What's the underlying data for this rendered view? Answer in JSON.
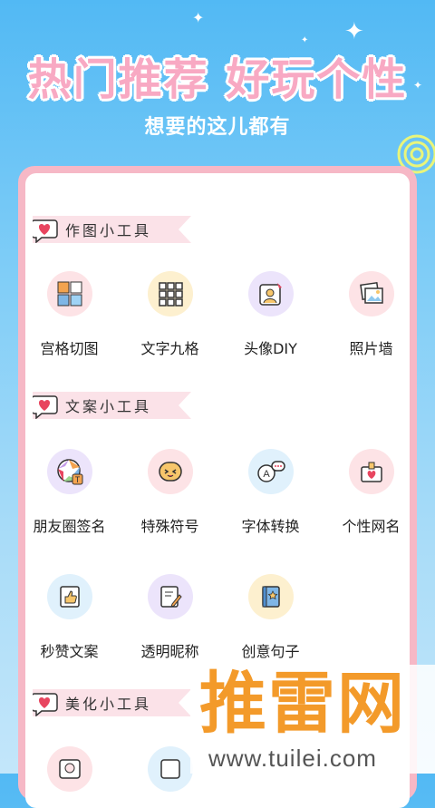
{
  "hero": {
    "title": "热门推荐  好玩个性",
    "subtitle": "想要的这儿都有"
  },
  "sections": [
    {
      "title": "作图小工具",
      "icon": "heart-chat-icon"
    },
    {
      "title": "文案小工具",
      "icon": "heart-chat-icon"
    },
    {
      "title": "美化小工具",
      "icon": "heart-chat-icon"
    }
  ],
  "tools": {
    "grid_cut": {
      "label": "宫格切图",
      "icon": "grid-cut-icon",
      "color": "#fde3e6"
    },
    "text_nine": {
      "label": "文字九格",
      "icon": "text-grid-icon",
      "color": "#fdf0cf"
    },
    "avatar_diy": {
      "label": "头像DIY",
      "icon": "avatar-edit-icon",
      "color": "#ece4fb"
    },
    "photo_wall": {
      "label": "照片墙",
      "icon": "photo-wall-icon",
      "color": "#fde3e6"
    },
    "moments_sign": {
      "label": "朋友圈签名",
      "icon": "camera-aperture-icon",
      "color": "#ece4fb"
    },
    "special_symbol": {
      "label": "特殊符号",
      "icon": "emoji-face-icon",
      "color": "#fde3e6"
    },
    "font_convert": {
      "label": "字体转换",
      "icon": "font-chat-icon",
      "color": "#e0f1fc"
    },
    "nickname": {
      "label": "个性网名",
      "icon": "heart-tag-icon",
      "color": "#fde3e6"
    },
    "like_copy": {
      "label": "秒赞文案",
      "icon": "thumbs-up-icon",
      "color": "#e0f1fc"
    },
    "transparent_nick": {
      "label": "透明昵称",
      "icon": "note-edit-icon",
      "color": "#ece4fb"
    },
    "creative_sentence": {
      "label": "创意句子",
      "icon": "star-book-icon",
      "color": "#fdf0cf"
    }
  },
  "watermark": {
    "brand": "推雷网",
    "url": "www.tuilei.com"
  },
  "colors": {
    "pink_accent": "#f8a9c3",
    "bg_blue": "#52b9f4",
    "watermark_orange": "#f39a2a"
  }
}
